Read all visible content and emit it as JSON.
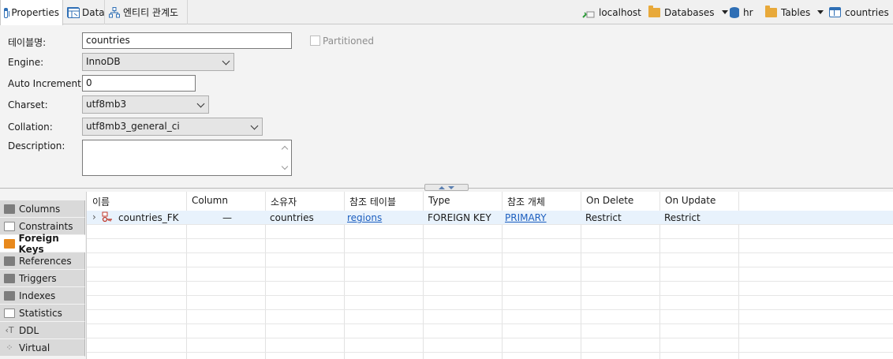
{
  "toolbar": {
    "tabs": [
      {
        "label": "Properties",
        "icon": "table-icon"
      },
      {
        "label": "Data",
        "icon": "data-icon"
      },
      {
        "label": "엔티티 관계도",
        "icon": "er-diagram-icon"
      }
    ],
    "breadcrumb": {
      "host": "localhost",
      "databases": "Databases",
      "schema": "hr",
      "tables": "Tables",
      "table": "countries"
    }
  },
  "properties": {
    "table_name_label": "테이블명:",
    "table_name_value": "countries",
    "partitioned_label": "Partitioned",
    "engine_label": "Engine:",
    "engine_value": "InnoDB",
    "auto_increment_label": "Auto Increment:",
    "auto_increment_value": "0",
    "charset_label": "Charset:",
    "charset_value": "utf8mb3",
    "collation_label": "Collation:",
    "collation_value": "utf8mb3_general_ci",
    "description_label": "Description:",
    "description_value": ""
  },
  "side_tabs": [
    {
      "label": "Columns",
      "icon": "columns-icon"
    },
    {
      "label": "Constraints",
      "icon": "constraints-icon"
    },
    {
      "label": "Foreign Keys",
      "icon": "foreign-keys-icon",
      "active": true
    },
    {
      "label": "References",
      "icon": "references-icon"
    },
    {
      "label": "Triggers",
      "icon": "triggers-icon"
    },
    {
      "label": "Indexes",
      "icon": "indexes-icon"
    },
    {
      "label": "Statistics",
      "icon": "statistics-icon"
    },
    {
      "label": "DDL",
      "icon": "ddl-icon"
    },
    {
      "label": "Virtual",
      "icon": "virtual-icon"
    }
  ],
  "grid": {
    "headers": [
      "이름",
      "Column",
      "소유자",
      "참조 테이블",
      "Type",
      "참조 개체",
      "On Delete",
      "On Update"
    ],
    "rows": [
      {
        "name": "countries_FK",
        "column": "—",
        "owner": "countries",
        "ref_table": "regions",
        "type": "FOREIGN KEY",
        "ref_object": "PRIMARY",
        "on_delete": "Restrict",
        "on_update": "Restrict"
      }
    ]
  },
  "colors": {
    "accent": "#2f6fb5",
    "folder": "#e8a93a",
    "active_side": "#e8891c",
    "link": "#1d5fbf",
    "selected_row": "#e8f2fc"
  }
}
